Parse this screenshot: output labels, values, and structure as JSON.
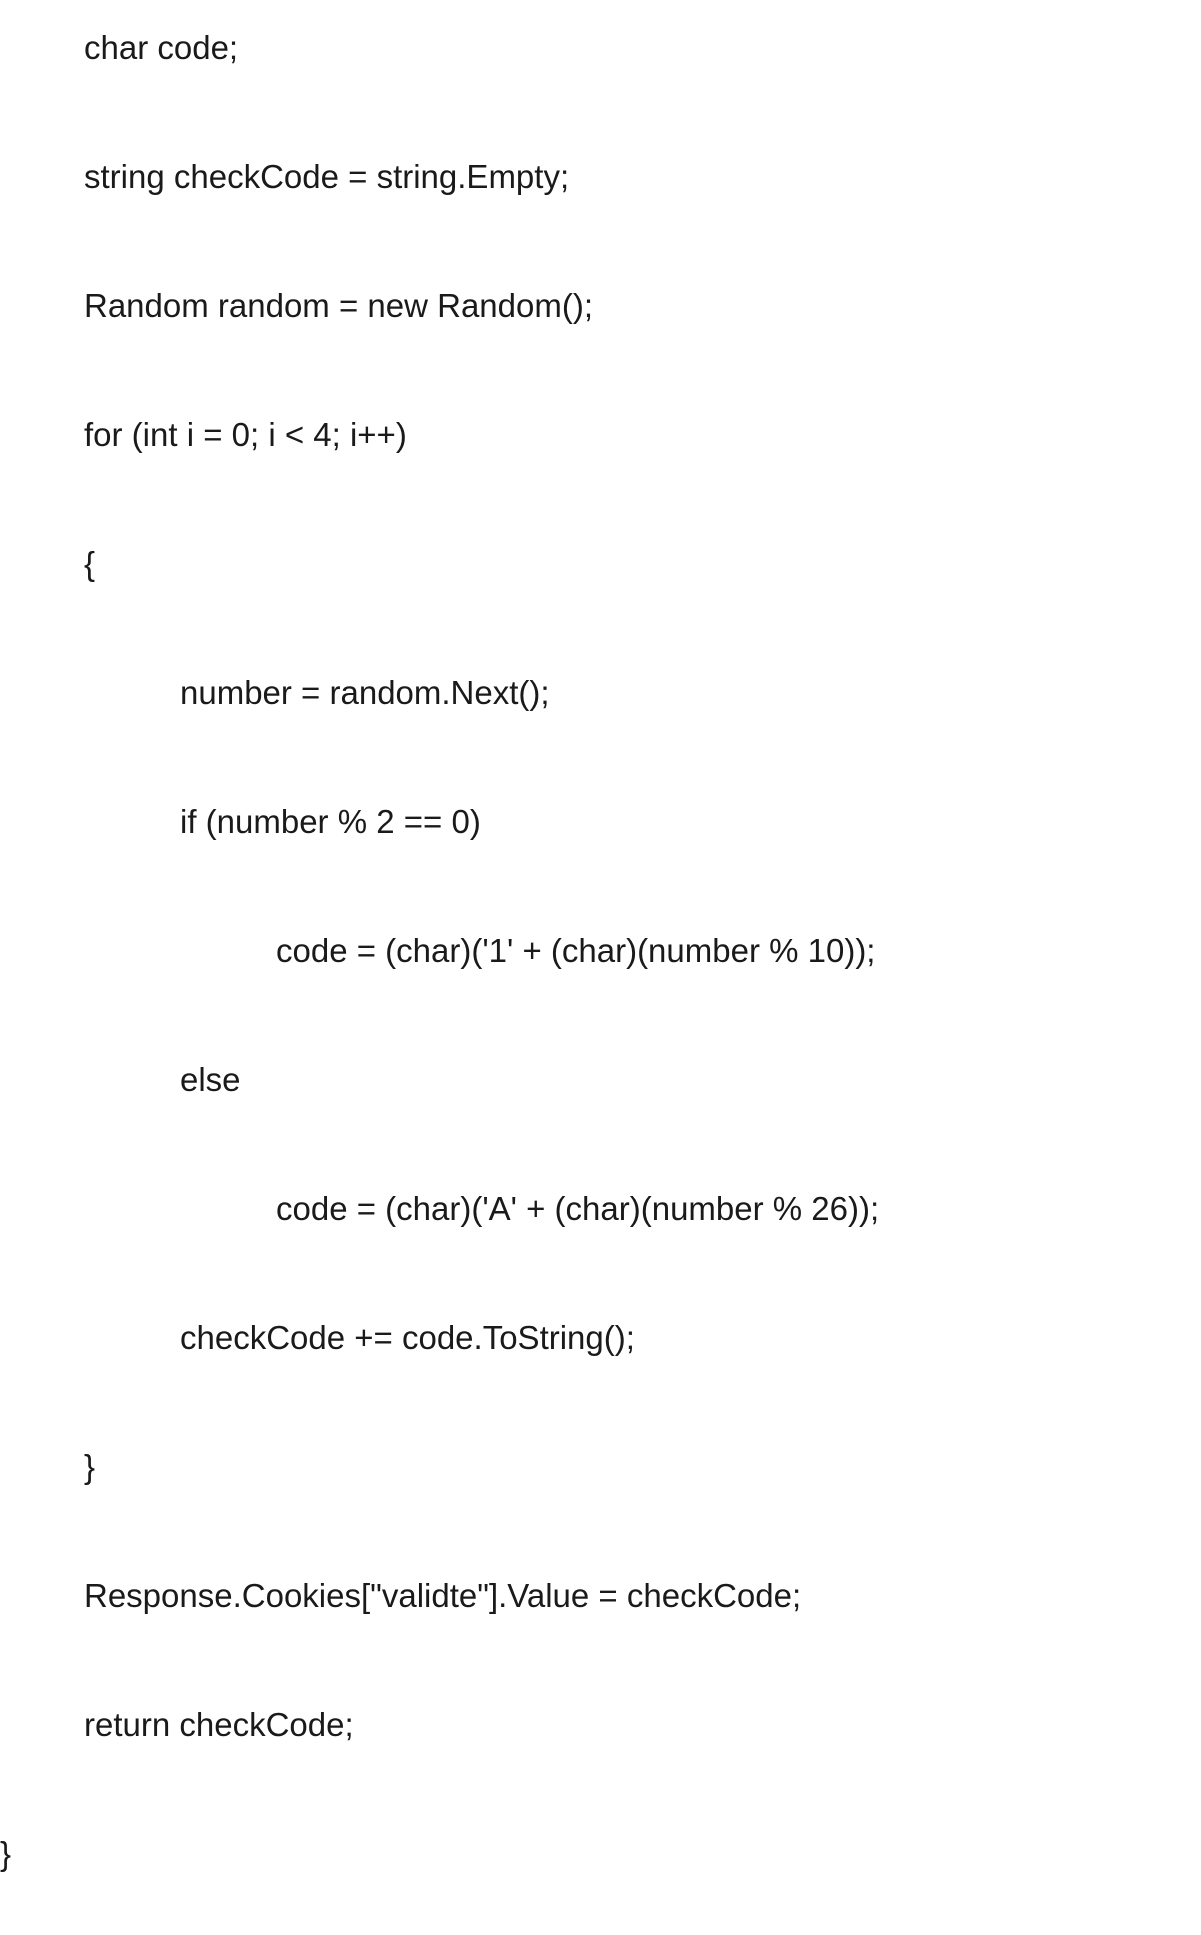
{
  "code": {
    "lines": [
      {
        "indent": 1,
        "text": "char code;"
      },
      {
        "indent": 1,
        "text": "string checkCode = string.Empty;"
      },
      {
        "indent": 1,
        "text": "Random random = new Random();"
      },
      {
        "indent": 1,
        "text": "for (int i = 0; i < 4; i++)"
      },
      {
        "indent": 1,
        "text": "{"
      },
      {
        "indent": 2,
        "text": "number = random.Next();"
      },
      {
        "indent": 2,
        "text": "if (number % 2 == 0)"
      },
      {
        "indent": 3,
        "text": "code = (char)('1' + (char)(number % 10));"
      },
      {
        "indent": 2,
        "text": "else"
      },
      {
        "indent": 3,
        "text": "code = (char)('A' + (char)(number % 26));"
      },
      {
        "indent": 2,
        "text": "checkCode += code.ToString();"
      },
      {
        "indent": 1,
        "text": "}"
      },
      {
        "indent": 1,
        "text": "Response.Cookies[\"validte\"].Value = checkCode;"
      },
      {
        "indent": 1,
        "text": "return checkCode;"
      },
      {
        "indent": 0,
        "text": "}"
      }
    ]
  }
}
